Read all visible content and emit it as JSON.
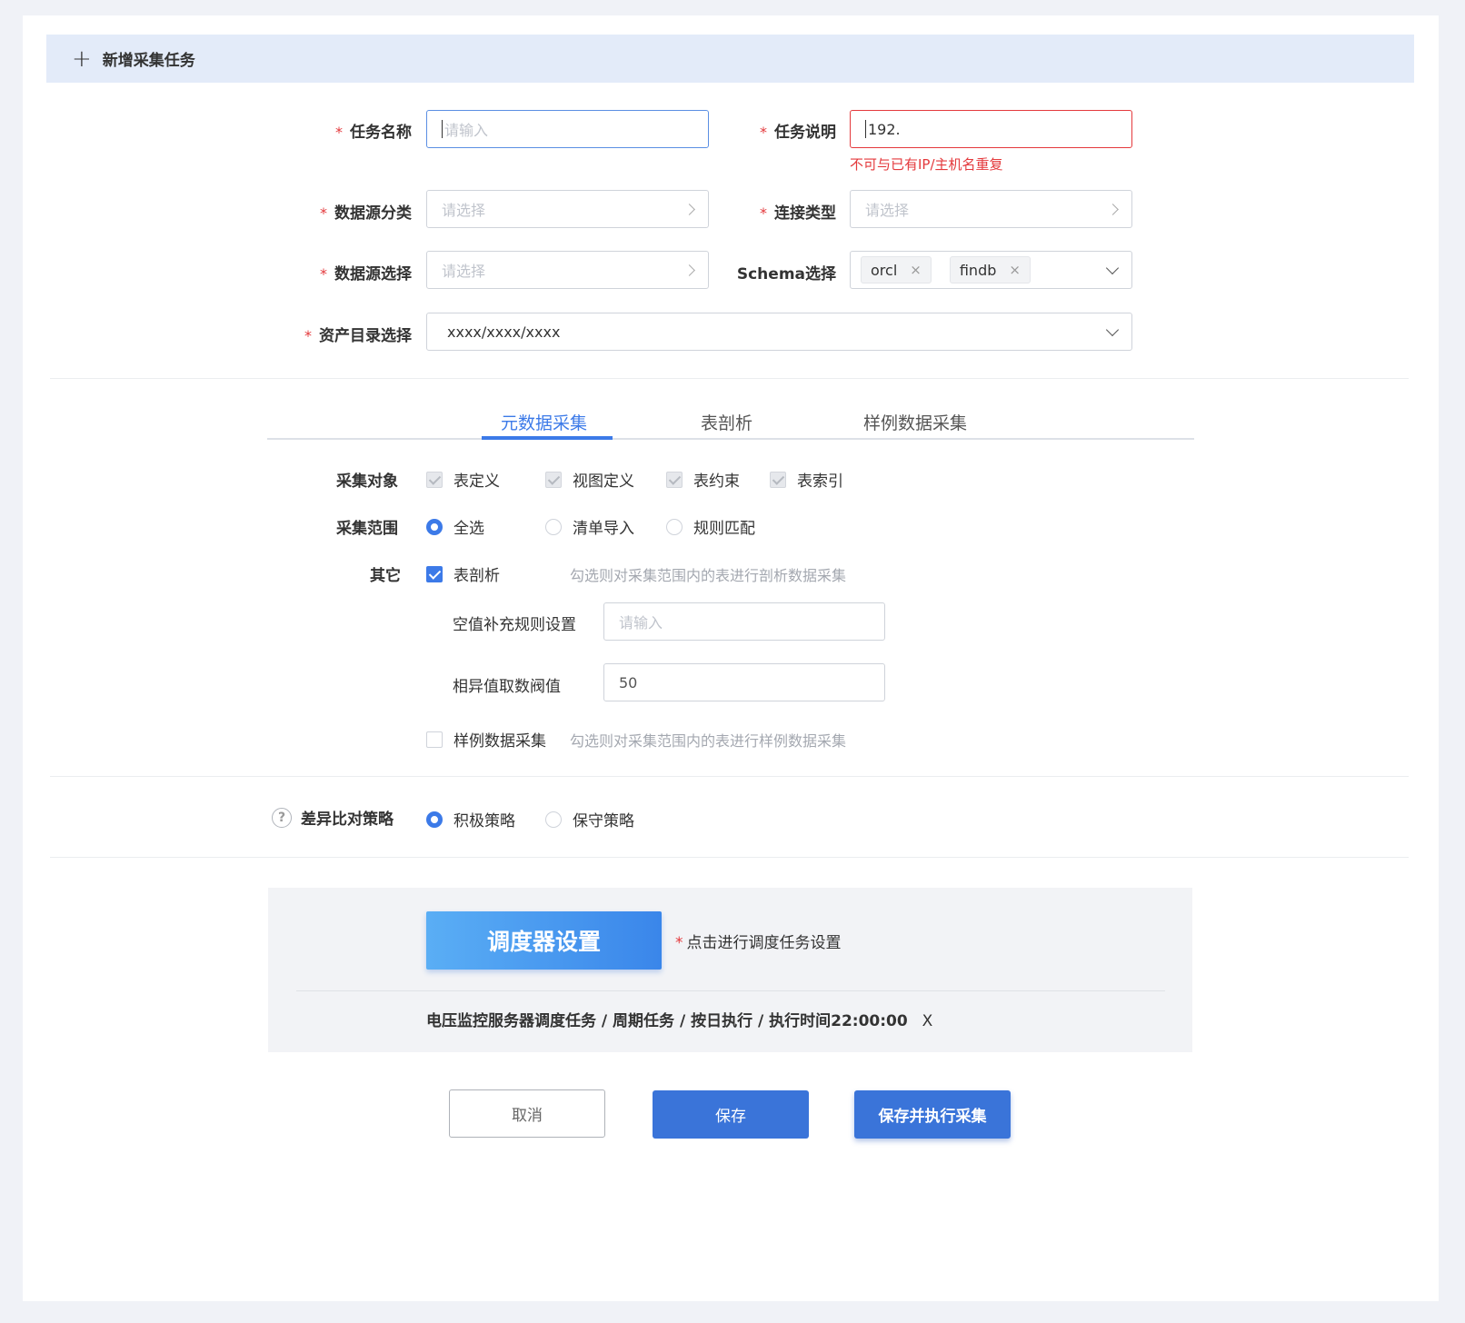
{
  "header": {
    "title": "新增采集任务"
  },
  "form": {
    "task_name": {
      "label": "任务名称",
      "placeholder": "请输入"
    },
    "task_desc": {
      "label": "任务说明",
      "value": "192.",
      "error": "不可与已有IP/主机名重复"
    },
    "ds_category": {
      "label": "数据源分类",
      "placeholder": "请选择"
    },
    "conn_type": {
      "label": "连接类型",
      "placeholder": "请选择"
    },
    "ds_select": {
      "label": "数据源选择",
      "placeholder": "请选择"
    },
    "schema": {
      "label": "Schema选择",
      "tags": [
        "orcl",
        "findb"
      ]
    },
    "asset_dir": {
      "label": "资产目录选择",
      "value": "xxxx/xxxx/xxxx"
    }
  },
  "tabs": [
    "元数据采集",
    "表剖析",
    "样例数据采集"
  ],
  "collect": {
    "objects_label": "采集对象",
    "objects": [
      "表定义",
      "视图定义",
      "表约束",
      "表索引"
    ],
    "scope_label": "采集范围",
    "scope": [
      "全选",
      "清单导入",
      "规则匹配"
    ],
    "other_label": "其它",
    "profile": {
      "label": "表剖析",
      "hint": "勾选则对采集范围内的表进行剖析数据采集"
    },
    "null_rule": {
      "label": "空值补充规则设置",
      "placeholder": "请输入"
    },
    "distinct": {
      "label": "相异值取数阀值",
      "value": "50"
    },
    "sample": {
      "label": "样例数据采集",
      "hint": "勾选则对采集范围内的表进行样例数据采集"
    }
  },
  "diff": {
    "help_glyph": "?",
    "label": "差异比对策略",
    "options": [
      "积极策略",
      "保守策略"
    ]
  },
  "schedule": {
    "button": "调度器设置",
    "note_star": "*",
    "note": "点击进行调度任务设置",
    "info": "电压监控服务器调度任务 / 周期任务 / 按日执行 / 执行时间22:00:00",
    "remove": "X"
  },
  "actions": {
    "cancel": "取消",
    "save": "保存",
    "save_exec": "保存并执行采集"
  },
  "icons": {
    "add": "plus-icon",
    "help": "question-icon"
  },
  "colors": {
    "accent": "#3c7ae8",
    "error": "#e4393c"
  }
}
